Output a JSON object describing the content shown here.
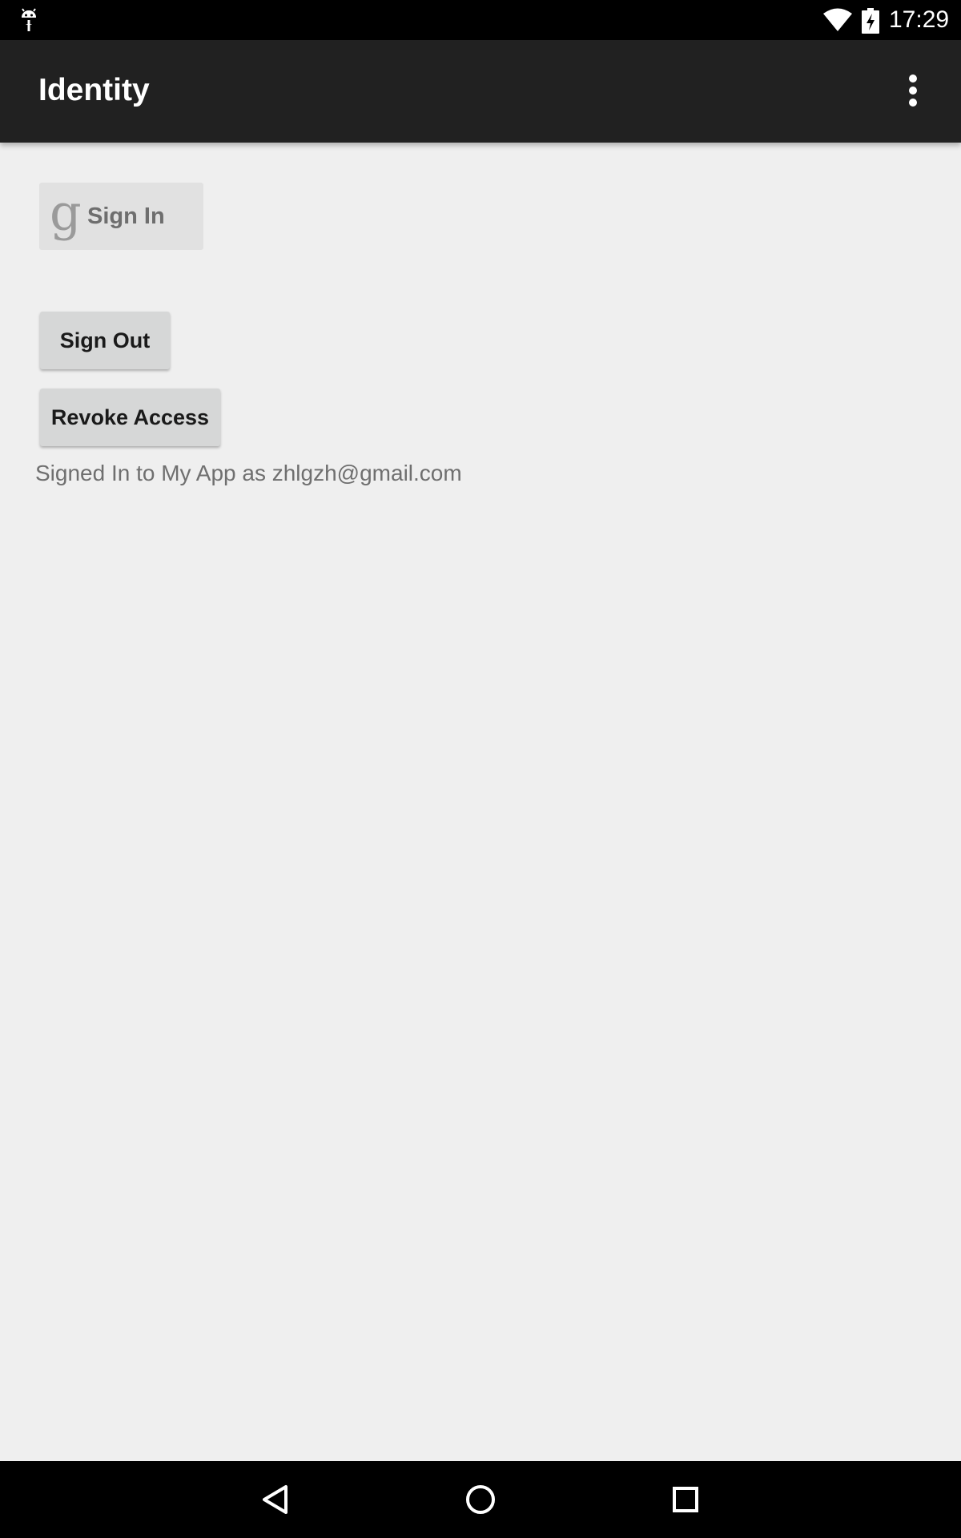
{
  "status_bar": {
    "time": "17:29",
    "icons": [
      "android-notification-icon",
      "wifi-icon",
      "battery-charging-icon"
    ]
  },
  "app_bar": {
    "title": "Identity",
    "overflow_icon": "more-vert-icon"
  },
  "main": {
    "sign_in_button": {
      "icon": "google-g-icon",
      "icon_glyph": "g",
      "label": "Sign In"
    },
    "sign_out_label": "Sign Out",
    "revoke_access_label": "Revoke Access",
    "status_text": "Signed In to My App as zhlgzh@gmail.com"
  },
  "nav_bar": {
    "icons": [
      "back-icon",
      "home-icon",
      "recents-icon"
    ]
  },
  "colors": {
    "status_bar": "#000000",
    "app_bar": "#212121",
    "background": "#efefef",
    "button": "#d6d7d7",
    "sign_in_button": "#e1e1e1",
    "secondary_text": "#6f6f6f"
  }
}
